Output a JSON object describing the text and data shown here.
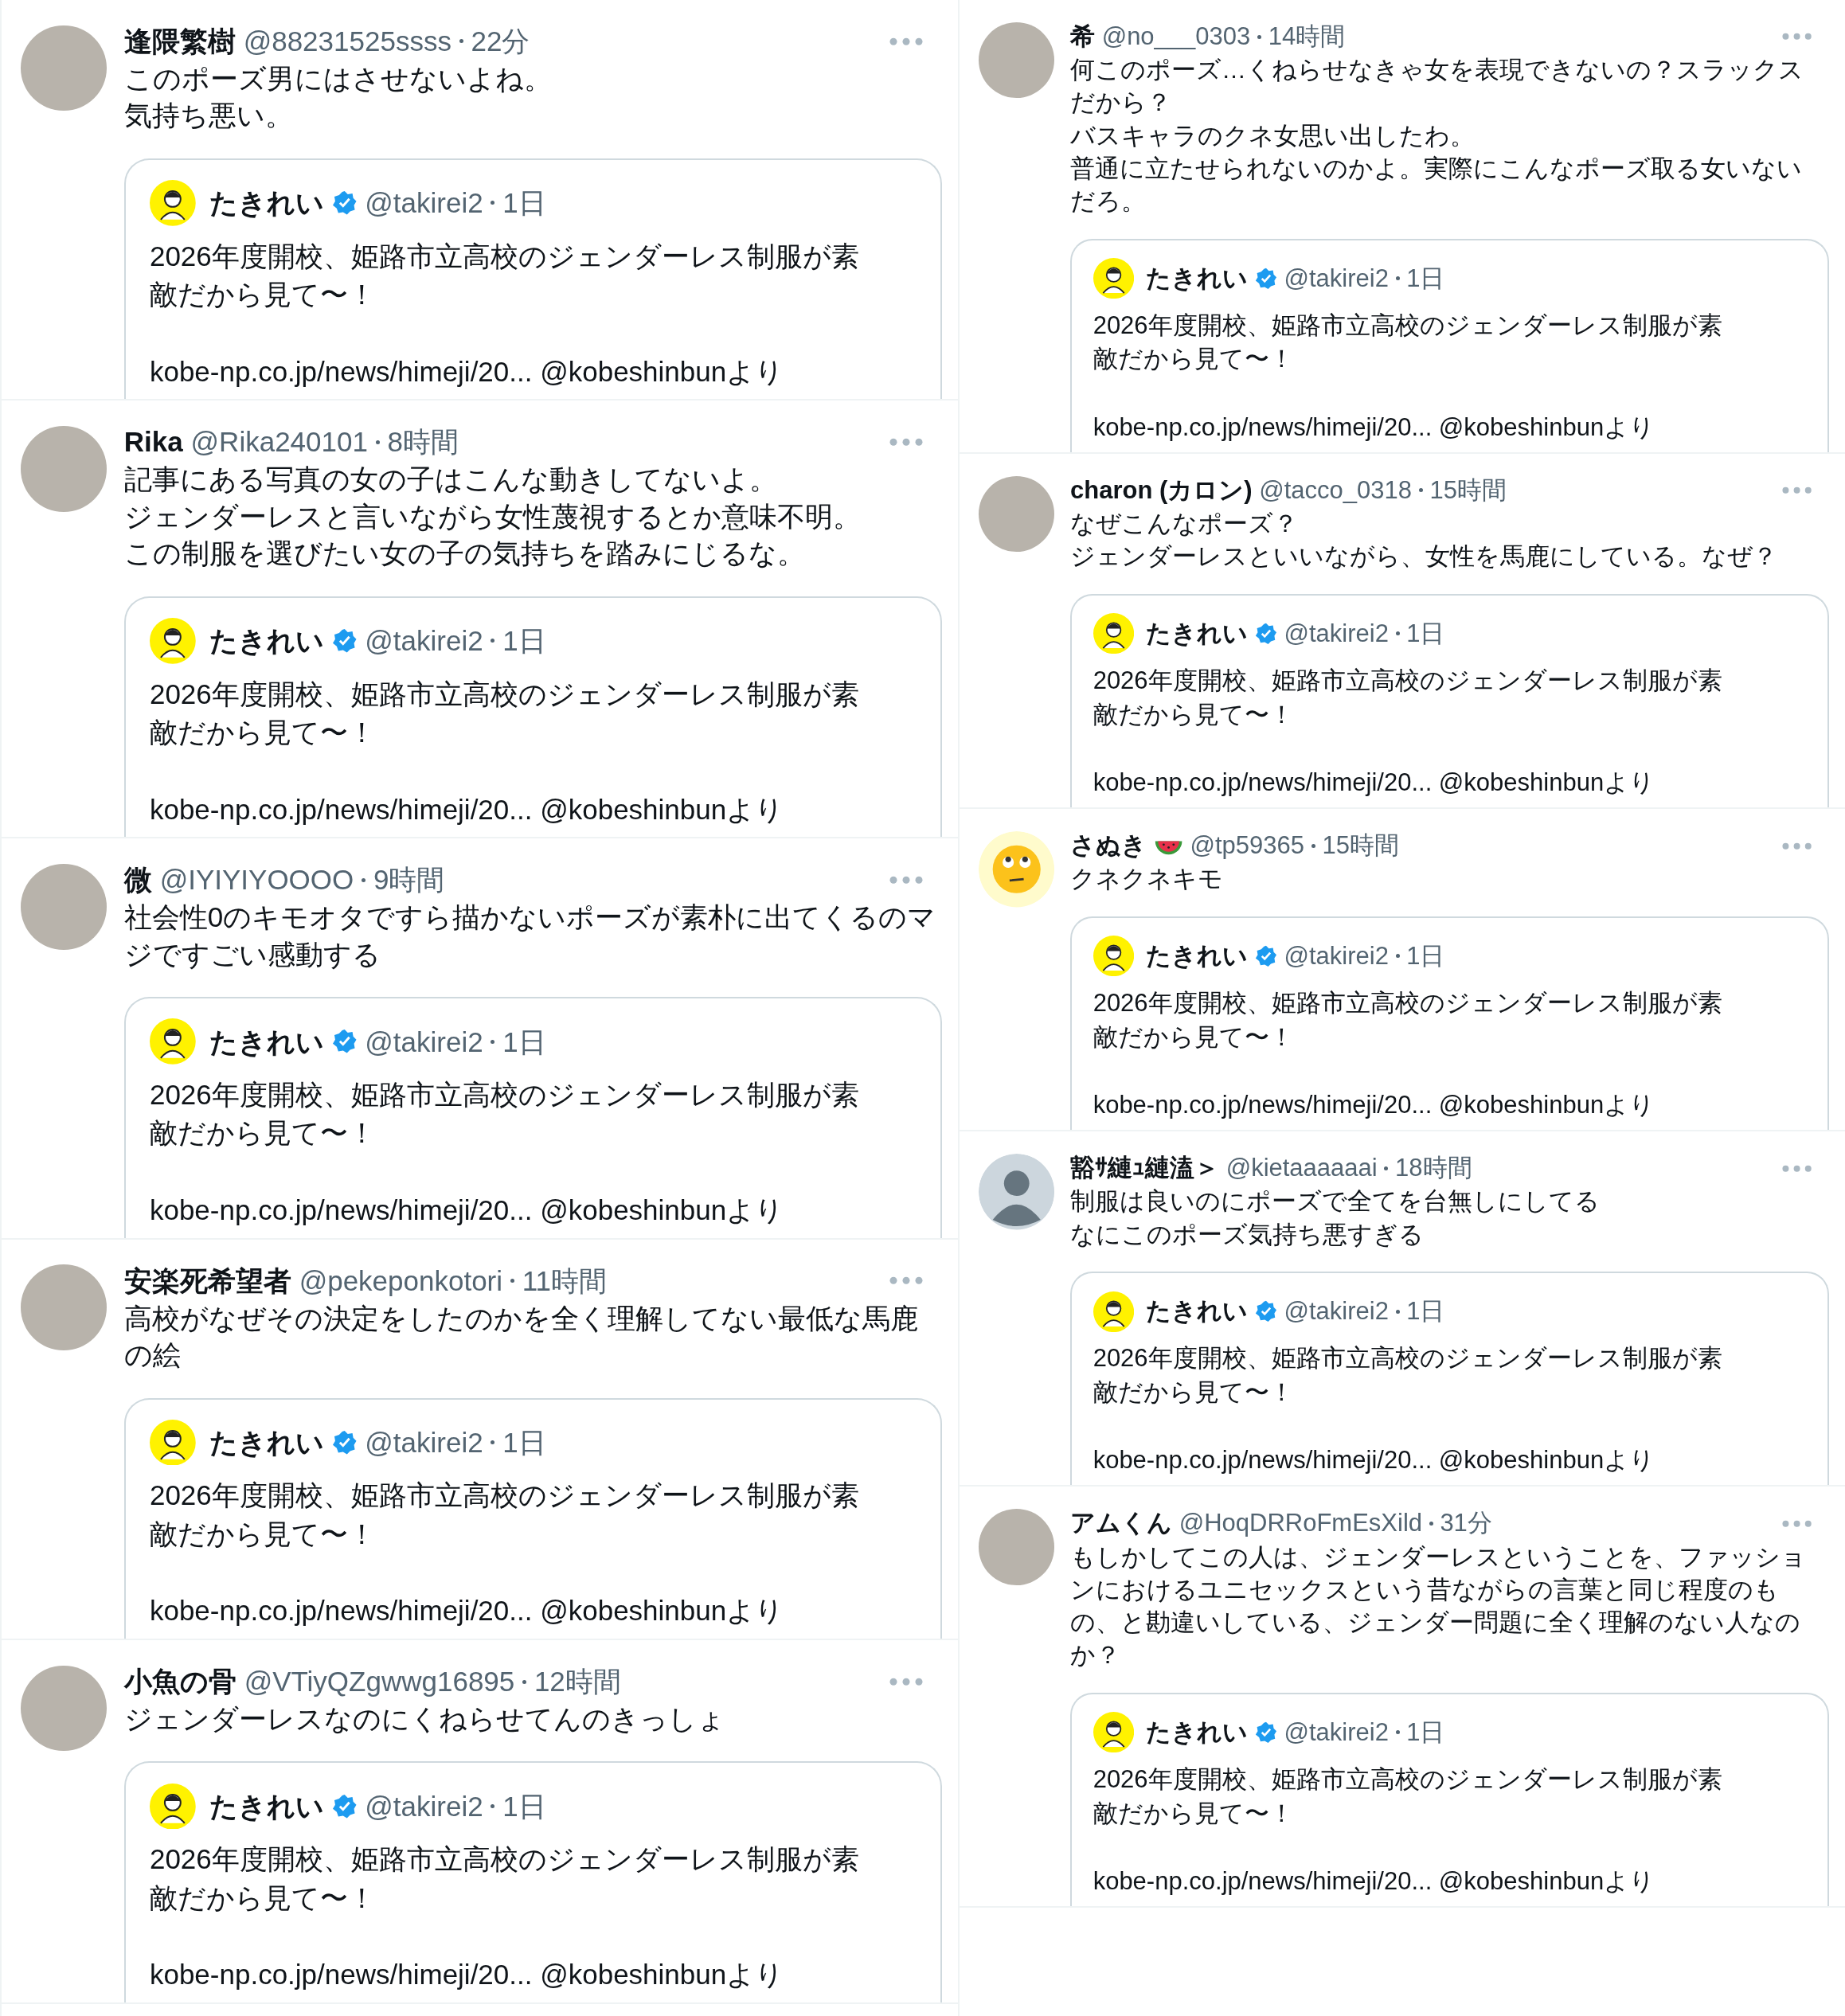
{
  "columns": [
    {
      "tweets": [
        {
          "avatar": {
            "kind": "photo"
          },
          "name": "逢隈繁樹",
          "handle": "@88231525ssss",
          "time": "22分",
          "text": [
            "このポーズ男にはさせないよね。",
            "気持ち悪い。"
          ],
          "quote": {
            "name": "たきれい",
            "verified": true,
            "handle": "@takirei2",
            "time": "1日",
            "text": "2026年度開校、姫路市立高校のジェンダーレス制服が素敵だから見て〜！",
            "link": "kobe-np.co.jp/news/himeji/20... @kobeshinbunより"
          }
        },
        {
          "avatar": {
            "kind": "photo"
          },
          "name": "Rika",
          "handle": "@Rika240101",
          "time": "8時間",
          "text": [
            "記事にある写真の女の子はこんな動きしてないよ。",
            "ジェンダーレスと言いながら女性蔑視するとか意味不明。",
            "この制服を選びたい女の子の気持ちを踏みにじるな。"
          ],
          "quote": {
            "name": "たきれい",
            "verified": true,
            "handle": "@takirei2",
            "time": "1日",
            "text": "2026年度開校、姫路市立高校のジェンダーレス制服が素敵だから見て〜！",
            "link": "kobe-np.co.jp/news/himeji/20... @kobeshinbunより"
          }
        },
        {
          "avatar": {
            "kind": "photo"
          },
          "name": "微",
          "handle": "@IYIYIYOOOO",
          "time": "9時間",
          "text": [
            "社会性0のキモオタですら描かないポーズが素朴に出てくるのマジですごい感動する"
          ],
          "quote": {
            "name": "たきれい",
            "verified": true,
            "handle": "@takirei2",
            "time": "1日",
            "text": "2026年度開校、姫路市立高校のジェンダーレス制服が素敵だから見て〜！",
            "link": "kobe-np.co.jp/news/himeji/20... @kobeshinbunより"
          }
        },
        {
          "avatar": {
            "kind": "photo"
          },
          "name": "安楽死希望者",
          "handle": "@pekeponkotori",
          "time": "11時間",
          "text": [
            "高校がなぜその決定をしたのかを全く理解してない最低な馬鹿の絵"
          ],
          "quote": {
            "name": "たきれい",
            "verified": true,
            "handle": "@takirei2",
            "time": "1日",
            "text": "2026年度開校、姫路市立高校のジェンダーレス制服が素敵だから見て〜！",
            "link": "kobe-np.co.jp/news/himeji/20... @kobeshinbunより"
          }
        },
        {
          "avatar": {
            "kind": "photo"
          },
          "name": "小魚の骨",
          "handle": "@VTiyQZgwwg16895",
          "time": "12時間",
          "text": [
            "ジェンダーレスなのにくねらせてんのきっしょ"
          ],
          "quote": {
            "name": "たきれい",
            "verified": true,
            "handle": "@takirei2",
            "time": "1日",
            "text": "2026年度開校、姫路市立高校のジェンダーレス制服が素敵だから見て〜！",
            "link": "kobe-np.co.jp/news/himeji/20... @kobeshinbunより"
          }
        }
      ]
    },
    {
      "tweets": [
        {
          "avatar": {
            "kind": "photo"
          },
          "name": "希",
          "handle": "@no___0303",
          "time": "14時間",
          "text": [
            "何このポーズ…くねらせなきゃ女を表現できないの？スラックスだから？",
            "バスキャラのクネ女思い出したわ。",
            "普通に立たせられないのかよ。実際にこんなポーズ取る女いないだろ。"
          ],
          "quote": {
            "name": "たきれい",
            "verified": true,
            "handle": "@takirei2",
            "time": "1日",
            "text": "2026年度開校、姫路市立高校のジェンダーレス制服が素敵だから見て〜！",
            "link": "kobe-np.co.jp/news/himeji/20... @kobeshinbunより"
          }
        },
        {
          "avatar": {
            "kind": "photo"
          },
          "name": "charon (カロン)",
          "handle": "@tacco_0318",
          "time": "15時間",
          "text": [
            "なぜこんなポーズ？",
            "ジェンダーレスといいながら、女性を馬鹿にしている。なぜ？"
          ],
          "quote": {
            "name": "たきれい",
            "verified": true,
            "handle": "@takirei2",
            "time": "1日",
            "text": "2026年度開校、姫路市立高校のジェンダーレス制服が素敵だから見て〜！",
            "link": "kobe-np.co.jp/news/himeji/20... @kobeshinbunより"
          }
        },
        {
          "avatar": {
            "kind": "emoji"
          },
          "name": "さぬき",
          "name_icon": {
            "kind": "watermelon"
          },
          "handle": "@tp59365",
          "time": "15時間",
          "text": [
            "クネクネキモ"
          ],
          "quote": {
            "name": "たきれい",
            "verified": true,
            "handle": "@takirei2",
            "time": "1日",
            "text": "2026年度開校、姫路市立高校のジェンダーレス制服が素敵だから見て〜！",
            "link": "kobe-np.co.jp/news/himeji/20... @kobeshinbunより"
          }
        },
        {
          "avatar": {
            "kind": "default"
          },
          "name": "豁ｻ縺ｭ縺溘＞",
          "handle": "@kietaaaaaai",
          "time": "18時間",
          "text": [
            "制服は良いのにポーズで全てを台無しにしてる",
            "なにこのポーズ気持ち悪すぎる"
          ],
          "quote": {
            "name": "たきれい",
            "verified": true,
            "handle": "@takirei2",
            "time": "1日",
            "text": "2026年度開校、姫路市立高校のジェンダーレス制服が素敵だから見て〜！",
            "link": "kobe-np.co.jp/news/himeji/20... @kobeshinbunより"
          }
        },
        {
          "avatar": {
            "kind": "photo"
          },
          "name": "アムくん",
          "handle": "@HoqDRRoFmEsXild",
          "time": "31分",
          "text": [
            "もしかしてこの人は、ジェンダーレスということを、ファッションにおけるユニセックスという昔ながらの言葉と同じ程度のもの、と勘違いしている、ジェンダー問題に全く理解のない人なのか？"
          ],
          "quote": {
            "name": "たきれい",
            "verified": true,
            "handle": "@takirei2",
            "time": "1日",
            "text": "2026年度開校、姫路市立高校のジェンダーレス制服が素敵だから見て〜！",
            "link": "kobe-np.co.jp/news/himeji/20... @kobeshinbunより"
          }
        }
      ]
    }
  ]
}
